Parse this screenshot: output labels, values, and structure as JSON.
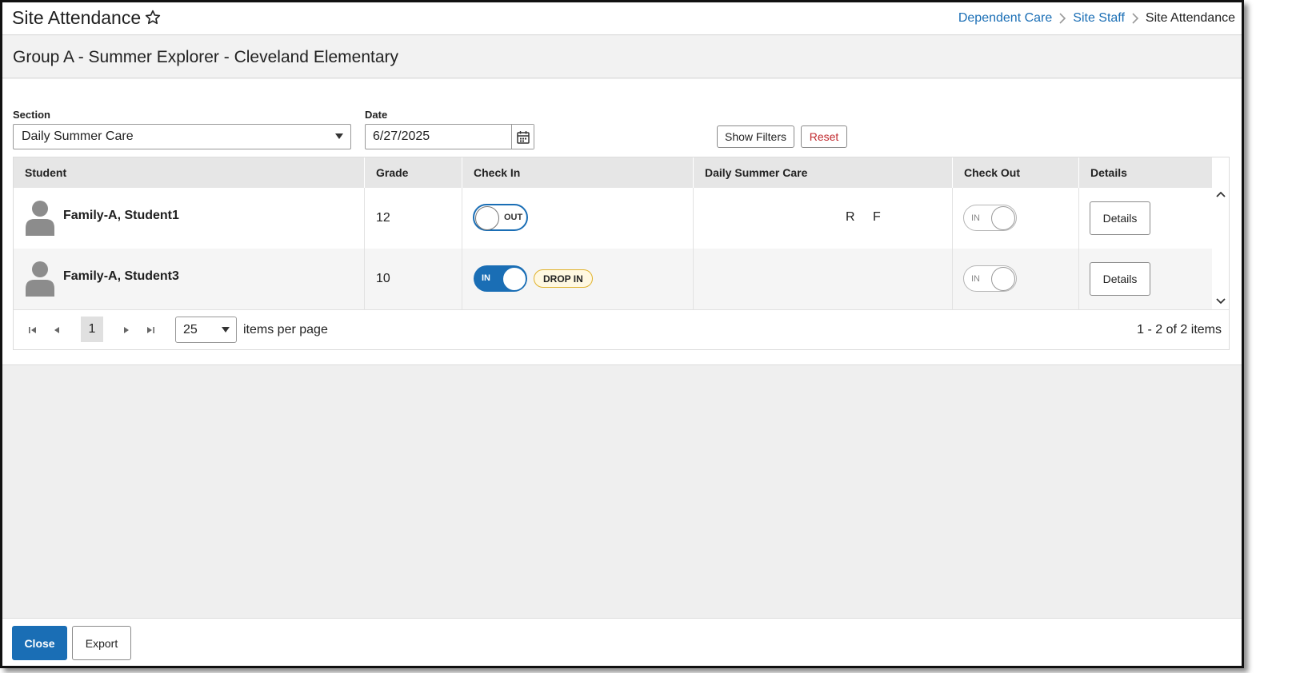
{
  "header": {
    "title": "Site Attendance",
    "favorite_icon": "star-outline-icon",
    "breadcrumb": [
      {
        "label": "Dependent Care",
        "link": true
      },
      {
        "label": "Site Staff",
        "link": true
      },
      {
        "label": "Site Attendance",
        "link": false
      }
    ]
  },
  "subheader": {
    "title": "Group A - Summer Explorer - Cleveland Elementary"
  },
  "filters": {
    "section_label": "Section",
    "section_value": "Daily Summer Care",
    "date_label": "Date",
    "date_value": "6/27/2025",
    "show_filters_label": "Show Filters",
    "reset_label": "Reset"
  },
  "grid": {
    "columns": [
      "Student",
      "Grade",
      "Check In",
      "Daily Summer Care",
      "Check Out",
      "Details"
    ],
    "rows": [
      {
        "student": "Family-A, Student1",
        "grade": "12",
        "check_in": {
          "state": "OUT",
          "on": false
        },
        "daily_codes": [
          "R",
          "F"
        ],
        "check_out": {
          "state": "IN",
          "on": false
        },
        "details_label": "Details"
      },
      {
        "student": "Family-A, Student3",
        "grade": "10",
        "check_in": {
          "state": "IN",
          "on": true
        },
        "badge": "DROP IN",
        "daily_codes": [],
        "check_out": {
          "state": "IN",
          "on": false
        },
        "details_label": "Details"
      }
    ]
  },
  "pager": {
    "current_page": "1",
    "per_page": "25",
    "per_page_label": "items per page",
    "item_count": "1 - 2 of 2 items"
  },
  "footer": {
    "close_label": "Close",
    "export_label": "Export"
  },
  "colors": {
    "accent": "#1a6eb5",
    "reset_text": "#c0282d",
    "badge_border": "#e0b22d"
  }
}
